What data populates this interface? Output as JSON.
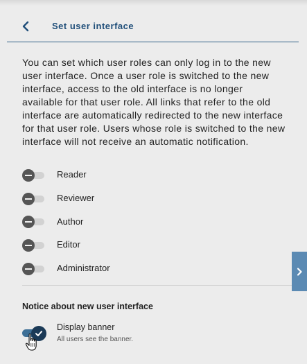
{
  "header": {
    "title": "Set user interface",
    "back_icon": "chevron-left-icon"
  },
  "description": "You can set which user roles can only log in to the new user interface. Once a user role is switched to the new interface, access to the old interface is no longer available for that user role. All links that refer to the old interface are automatically redirected to the new interface for that user role. Users whose role is switched to the new interface will not receive an automatic notification.",
  "roles": [
    {
      "label": "Reader",
      "enabled": false
    },
    {
      "label": "Reviewer",
      "enabled": false
    },
    {
      "label": "Author",
      "enabled": false
    },
    {
      "label": "Editor",
      "enabled": false
    },
    {
      "label": "Administrator",
      "enabled": false
    }
  ],
  "notice": {
    "title": "Notice about new user interface",
    "banner_label": "Display banner",
    "banner_sub": "All users see the banner.",
    "banner_enabled": true
  },
  "side_tab_icon": "chevron-right-icon",
  "colors": {
    "accent": "#1f4e79",
    "toggle_on": "#1b3a57",
    "side_tab": "#5b8ab3"
  }
}
